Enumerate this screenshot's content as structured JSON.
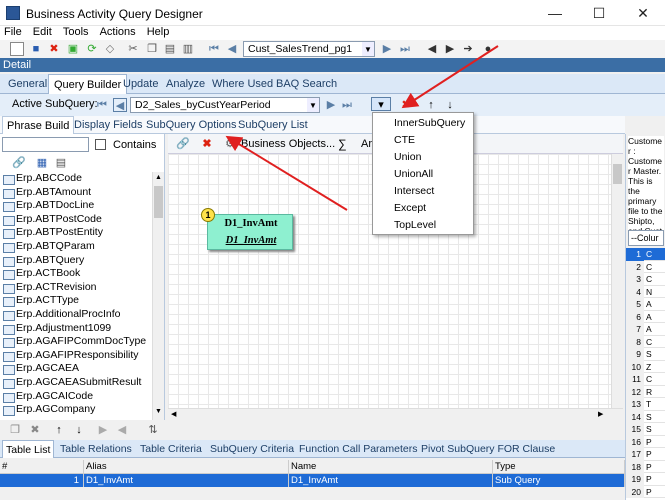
{
  "window": {
    "title": "Business Activity Query Designer",
    "minimize": "—",
    "maximize": "☐",
    "close": "✕"
  },
  "menu": [
    "File",
    "Edit",
    "Tools",
    "Actions",
    "Help"
  ],
  "toolbar": {
    "query_combo": "Cust_SalesTrend_pg1"
  },
  "detail_label": "Detail",
  "main_tabs": [
    "General",
    "Query Builder",
    "Update",
    "Analyze",
    "Where Used",
    "BAQ Search"
  ],
  "active_subquery": {
    "label": "Active SubQuery:",
    "value": "D2_Sales_byCustYearPeriod"
  },
  "sub_tabs": [
    "Phrase Build",
    "Display Fields",
    "SubQuery Options",
    "SubQuery List"
  ],
  "left_panel": {
    "contains_label": "Contains",
    "tables": [
      "Erp.ABCCode",
      "Erp.ABTAmount",
      "Erp.ABTDocLine",
      "Erp.ABTPostCode",
      "Erp.ABTPostEntity",
      "Erp.ABTQParam",
      "Erp.ABTQuery",
      "Erp.ACTBook",
      "Erp.ACTRevision",
      "Erp.ACTType",
      "Erp.AdditionalProcInfo",
      "Erp.Adjustment1099",
      "Erp.AGAFIPCommDocType",
      "Erp.AGAFIPResponsibility",
      "Erp.AGCAEA",
      "Erp.AGCAEASubmitResult",
      "Erp.AGCAICode",
      "Erp.AGCompany"
    ]
  },
  "canvas": {
    "business_objects": "Business Objects...",
    "sigma": "∑",
    "ar_label": "Ar",
    "node": {
      "badge": "1",
      "title": "D1_InvAmt",
      "alias": "D1_InvAmt"
    }
  },
  "dropdown_items": [
    "InnerSubQuery",
    "CTE",
    "Union",
    "UnionAll",
    "Intersect",
    "Except",
    "TopLevel"
  ],
  "right_panel": {
    "description": "Custome r : Custome r Master. This is the primary file to the Shipto, and Cust",
    "column_combo": "--Colur",
    "row_numbers": [
      "1",
      "2",
      "3",
      "4",
      "5",
      "6",
      "7",
      "8",
      "9",
      "10",
      "11",
      "12",
      "13",
      "14",
      "15",
      "16",
      "17",
      "18",
      "19",
      "20"
    ],
    "row_letters": [
      "C",
      "C",
      "C",
      "N",
      "A",
      "A",
      "A",
      "C",
      "S",
      "Z",
      "C",
      "R",
      "T",
      "S",
      "S",
      "P",
      "P",
      "P",
      "P",
      "P"
    ]
  },
  "bottom": {
    "tabs": [
      "Table List",
      "Table Relations",
      "Table Criteria",
      "SubQuery Criteria",
      "Function Call Parameters",
      "Pivot SubQuery FOR Clause"
    ],
    "columns": [
      "#",
      "Alias",
      "Name",
      "Type"
    ],
    "rows": [
      {
        "num": "1",
        "alias": "D1_InvAmt",
        "name": "D1_InvAmt",
        "type": "Sub Query"
      }
    ]
  },
  "colors": {
    "accent": "#1e6bd6",
    "node": "#8ef0d0",
    "arrow": "#e02020",
    "detail_bar": "#3b6ea5"
  }
}
